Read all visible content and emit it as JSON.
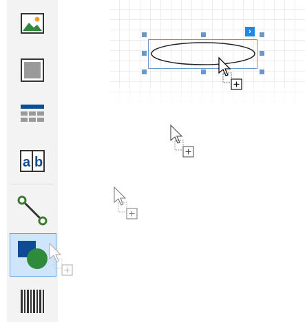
{
  "toolbox": {
    "items": [
      {
        "name": "picture-box-tool",
        "icon": "picture-icon"
      },
      {
        "name": "panel-tool",
        "icon": "panel-icon"
      },
      {
        "name": "table-tool",
        "icon": "table-icon"
      },
      {
        "name": "label-tool",
        "icon": "label-ab-icon",
        "text_a": "a",
        "text_b": "b"
      },
      {
        "name": "line-tool",
        "icon": "line-icon"
      },
      {
        "name": "shape-tool",
        "icon": "shape-icon",
        "active": true
      },
      {
        "name": "barcode-tool",
        "icon": "barcode-icon"
      }
    ]
  },
  "canvas": {
    "selected_control": "ellipse-shape",
    "smart_tag_glyph": "›"
  },
  "colors": {
    "accent": "#1e88e5",
    "selection": "#6b97c6",
    "shape_blue": "#0d4c94",
    "shape_green": "#2e8b3a",
    "line_green": "#3a7d2e"
  }
}
